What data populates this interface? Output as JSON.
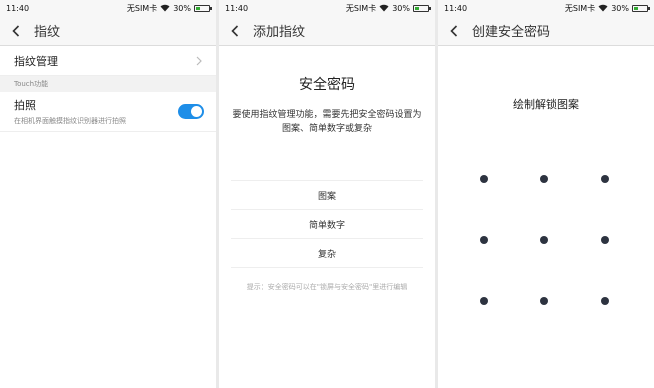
{
  "status_bar": {
    "time": "11:40",
    "carrier": "无SIM卡",
    "battery": "30%"
  },
  "screen1": {
    "title": "指纹",
    "menu_item": "指纹管理",
    "section_label": "Touch功能",
    "toggle_item": {
      "label": "拍照",
      "description": "在相机界面触摸指纹识别器进行拍照",
      "enabled": true
    }
  },
  "screen2": {
    "title": "添加指纹",
    "heading": "安全密码",
    "description": "要使用指纹管理功能，需要先把安全密码设置为图案、简单数字或复杂",
    "options": [
      "图案",
      "简单数字",
      "复杂"
    ],
    "hint": "提示：安全密码可以在\"锁屏与安全密码\"里进行编辑"
  },
  "screen3": {
    "title": "创建安全密码",
    "instruction": "绘制解锁图案"
  },
  "colors": {
    "toggle_on": "#1e8ee8",
    "dot": "#2d3340",
    "battery": "#33aa33"
  }
}
